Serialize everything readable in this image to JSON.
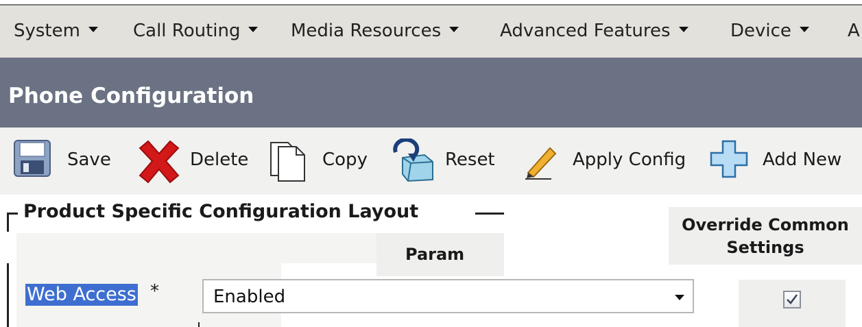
{
  "menu": {
    "items": [
      "System",
      "Call Routing",
      "Media Resources",
      "Advanced Features",
      "Device",
      "A"
    ]
  },
  "header": {
    "title": "Phone Configuration"
  },
  "toolbar": {
    "save_label": "Save",
    "delete_label": "Delete",
    "copy_label": "Copy",
    "reset_label": "Reset",
    "apply_config_label": "Apply Config",
    "add_new_label": "Add New",
    "icons": [
      "save-icon",
      "delete-icon",
      "copy-icon",
      "reset-icon",
      "apply-config-icon",
      "add-new-icon"
    ]
  },
  "section": {
    "legend": "Product Specific Configuration Layout",
    "param_header": "Param",
    "override_header_line1": "Override Common",
    "override_header_line2": "Settings",
    "row": {
      "label": "Web Access",
      "required_mark": "*",
      "value": "Enabled",
      "override_checked": true
    }
  },
  "colors": {
    "menu_bg": "#e3e1dc",
    "header_bg": "#6a7283",
    "toolbar_bg": "#f1f1ef",
    "selection_bg": "#3e6fd0"
  }
}
